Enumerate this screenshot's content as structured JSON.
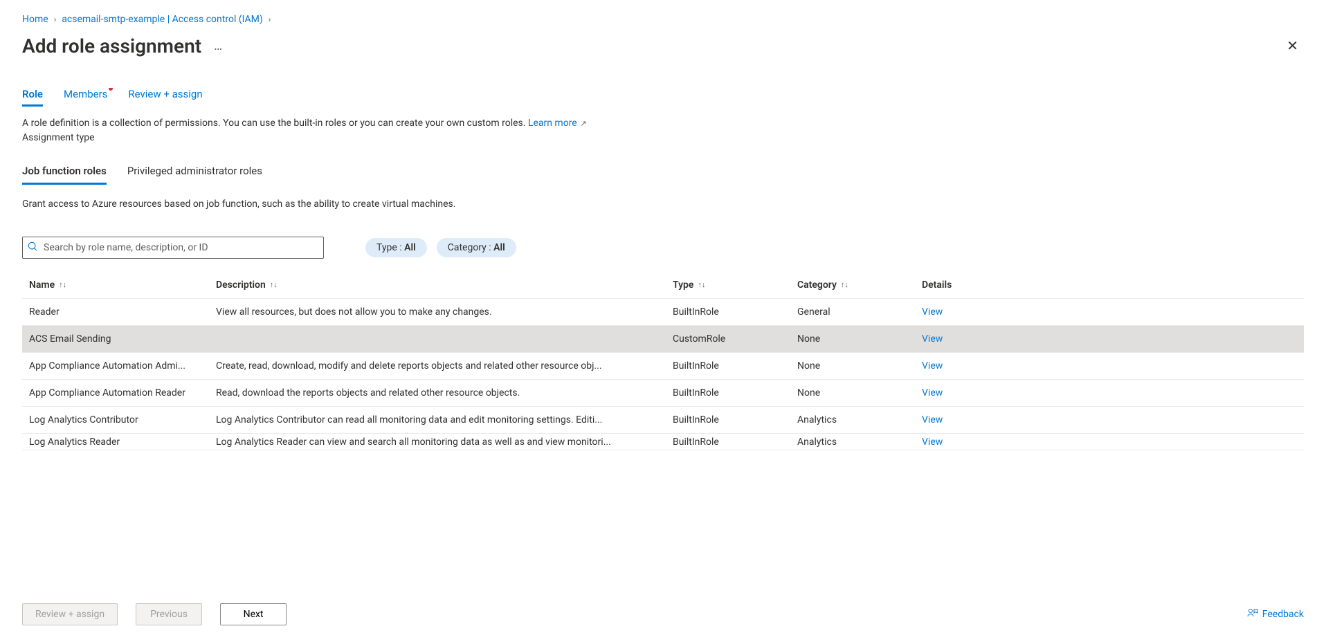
{
  "breadcrumb": {
    "home": "Home",
    "resource": "acsemail-smtp-example | Access control (IAM)"
  },
  "page": {
    "title": "Add role assignment"
  },
  "tabs": {
    "role": "Role",
    "members": "Members",
    "review": "Review + assign"
  },
  "helper": {
    "text": "A role definition is a collection of permissions. You can use the built-in roles or you can create your own custom roles. ",
    "learn_more": "Learn more",
    "assignment_type": "Assignment type"
  },
  "subtabs": {
    "job": "Job function roles",
    "privileged": "Privileged administrator roles"
  },
  "job_desc": "Grant access to Azure resources based on job function, such as the ability to create virtual machines.",
  "search": {
    "placeholder": "Search by role name, description, or ID"
  },
  "filters": {
    "type_label": "Type : ",
    "type_value": "All",
    "category_label": "Category : ",
    "category_value": "All"
  },
  "columns": {
    "name": "Name",
    "description": "Description",
    "type": "Type",
    "category": "Category",
    "details": "Details"
  },
  "rows": [
    {
      "name": "Reader",
      "description": "View all resources, but does not allow you to make any changes.",
      "type": "BuiltInRole",
      "category": "General",
      "details": "View",
      "selected": false
    },
    {
      "name": "ACS Email Sending",
      "description": "",
      "type": "CustomRole",
      "category": "None",
      "details": "View",
      "selected": true
    },
    {
      "name": "App Compliance Automation Admi...",
      "description": "Create, read, download, modify and delete reports objects and related other resource obj...",
      "type": "BuiltInRole",
      "category": "None",
      "details": "View",
      "selected": false
    },
    {
      "name": "App Compliance Automation Reader",
      "description": "Read, download the reports objects and related other resource objects.",
      "type": "BuiltInRole",
      "category": "None",
      "details": "View",
      "selected": false
    },
    {
      "name": "Log Analytics Contributor",
      "description": "Log Analytics Contributor can read all monitoring data and edit monitoring settings. Editi...",
      "type": "BuiltInRole",
      "category": "Analytics",
      "details": "View",
      "selected": false
    },
    {
      "name": "Log Analytics Reader",
      "description": "Log Analytics Reader can view and search all monitoring data as well as and view monitori...",
      "type": "BuiltInRole",
      "category": "Analytics",
      "details": "View",
      "selected": false
    }
  ],
  "footer": {
    "review": "Review + assign",
    "previous": "Previous",
    "next": "Next",
    "feedback": "Feedback"
  }
}
